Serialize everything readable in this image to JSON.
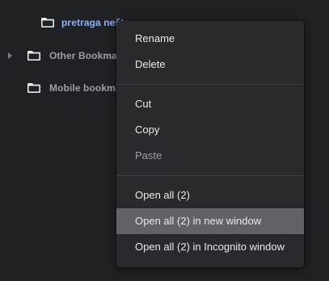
{
  "bookmarks_tree": {
    "items": [
      {
        "label": "pretraga nešto",
        "selected": true
      },
      {
        "label": "Other Bookmarks",
        "expandable": true
      },
      {
        "label": "Mobile bookmarks"
      }
    ]
  },
  "context_menu": {
    "rename": "Rename",
    "delete": "Delete",
    "cut": "Cut",
    "copy": "Copy",
    "paste": "Paste",
    "open_all": "Open all (2)",
    "open_all_new_window": "Open all (2) in new window",
    "open_all_incognito": "Open all (2) in Incognito window",
    "highlighted_item": "Open all (2) in new window",
    "disabled_items": [
      "Paste"
    ]
  },
  "colors": {
    "background": "#202124",
    "menu_background": "#292a2d",
    "menu_highlight": "#5f6368",
    "text": "#e8eaed",
    "text_disabled": "#9aa0a6",
    "selected_label": "#8ab4f8"
  },
  "icons": {
    "folder": "folder-icon",
    "expander": "chevron-right-icon"
  }
}
